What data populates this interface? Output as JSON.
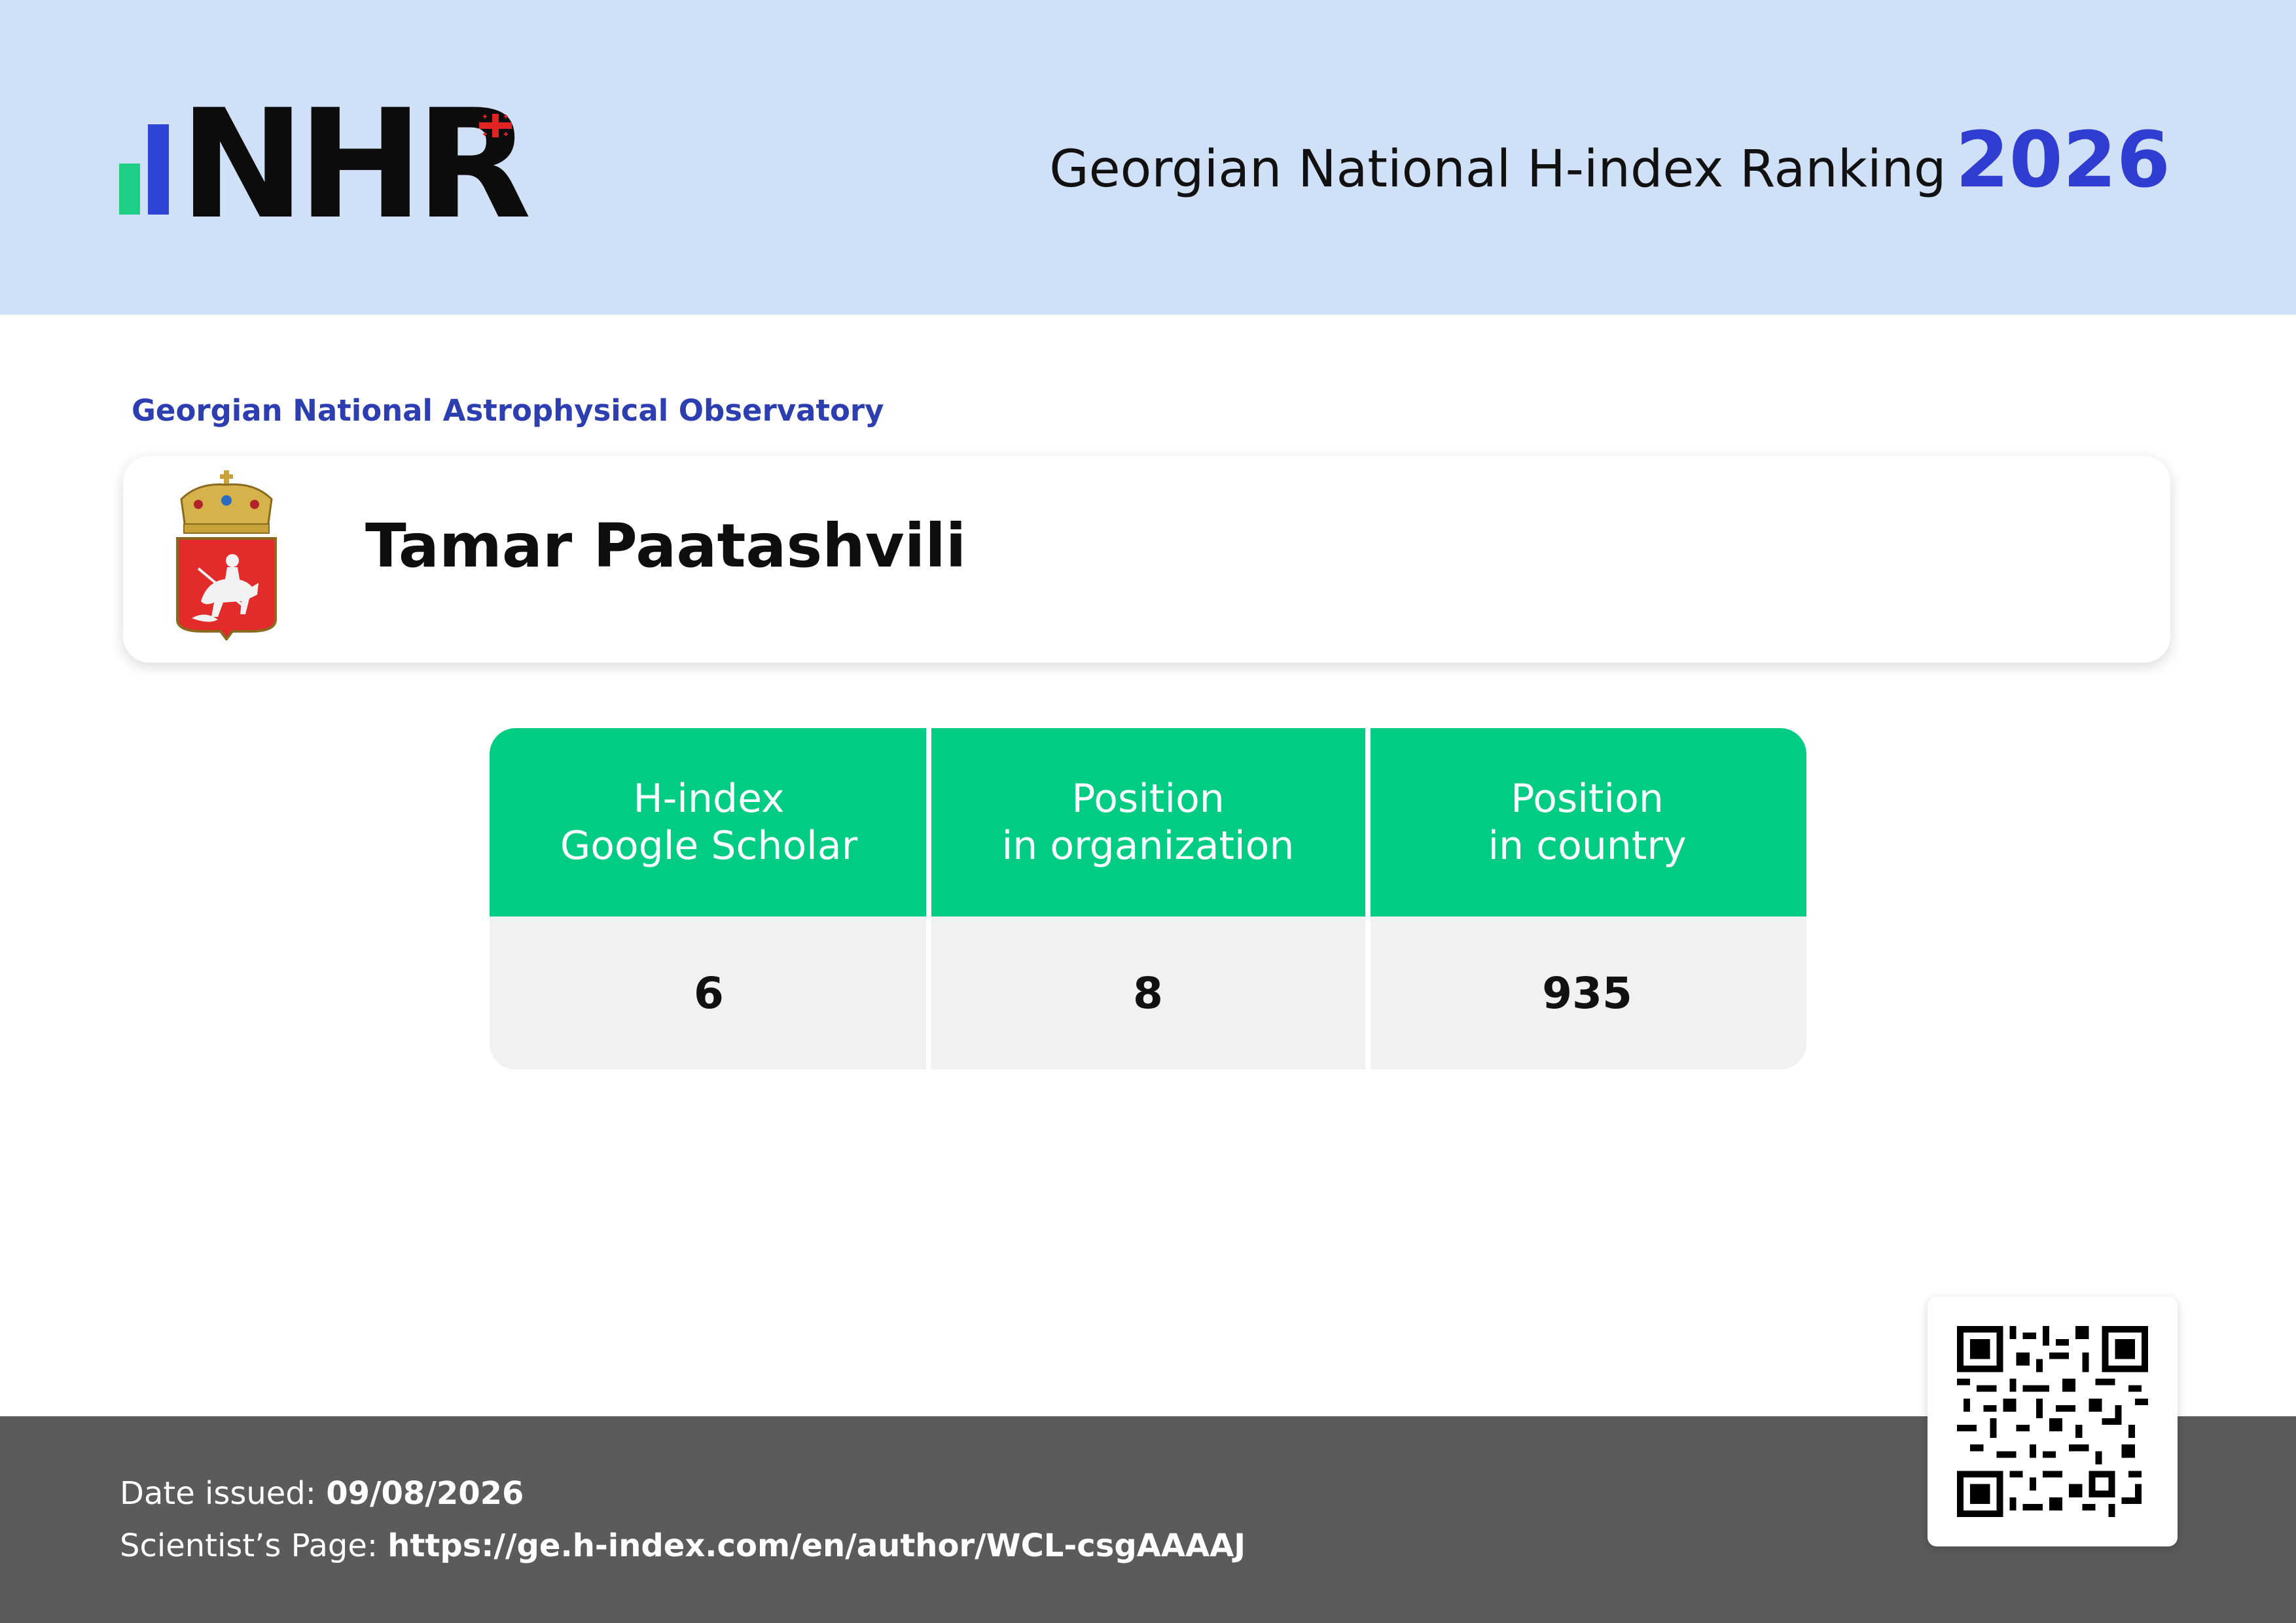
{
  "header": {
    "logo_text": "NHR",
    "title": "Georgian National H-index Ranking",
    "year": "2026"
  },
  "organization": "Georgian National Astrophysical Observatory",
  "scientist": {
    "name": "Tamar Paatashvili"
  },
  "stats": [
    {
      "label_line1": "H-index",
      "label_line2": "Google Scholar",
      "value": "6"
    },
    {
      "label_line1": "Position",
      "label_line2": "in organization",
      "value": "8"
    },
    {
      "label_line1": "Position",
      "label_line2": "in country",
      "value": "935"
    }
  ],
  "footer": {
    "date_label": "Date issued:",
    "date_value": "09/08/2026",
    "page_label": "Scientist’s Page:",
    "page_url": "https://ge.h-index.com/en/author/WCL-csgAAAAJ"
  },
  "colors": {
    "header_bg": "#cfe0f7",
    "accent_blue": "#2f3ed0",
    "table_green": "#00cc84",
    "footer_bg": "#5b5b5b"
  }
}
